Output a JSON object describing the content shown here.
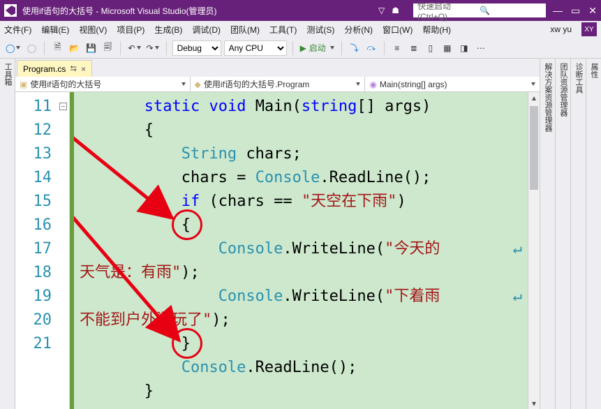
{
  "titlebar": {
    "title": "使用if语句的大括号 - Microsoft Visual Studio(管理员)",
    "search_placeholder": "快速启动 (Ctrl+Q)"
  },
  "menubar": {
    "items": [
      "文件(F)",
      "编辑(E)",
      "视图(V)",
      "项目(P)",
      "生成(B)",
      "调试(D)",
      "团队(M)",
      "工具(T)",
      "测试(S)",
      "分析(N)",
      "窗口(W)",
      "帮助(H)"
    ],
    "user": "xw yu",
    "user_badge": "XY"
  },
  "toolbar": {
    "config": "Debug",
    "platform": "Any CPU",
    "start": "启动"
  },
  "sidetabs": {
    "left": "工具箱",
    "right": [
      "解决方案资源管理器",
      "团队资源管理器",
      "诊断工具",
      "属性"
    ]
  },
  "tab": {
    "name": "Program.cs"
  },
  "navbar": {
    "seg1": "使用if语句的大括号",
    "seg2": "使用if语句的大括号.Program",
    "seg3": "Main(string[] args)"
  },
  "code": {
    "lines": [
      "11",
      "12",
      "13",
      "14",
      "15",
      "16",
      "17",
      "",
      "18",
      "",
      "19",
      "20",
      "21"
    ]
  },
  "tokens": {
    "static": "static",
    "void": "void",
    "Main": "Main",
    "string_kw": "string",
    "args": "args",
    "String": "String",
    "chars": "chars",
    "Console": "Console",
    "ReadLine": "ReadLine",
    "WriteLine": "WriteLine",
    "if": "if",
    "eq": "==",
    "str1": "\"天空在下雨\"",
    "str2a": "\"今天的",
    "str2b": "天气是：有雨\"",
    "str3a": "\"下着雨",
    "str3b": "不能到户外游玩了\""
  }
}
